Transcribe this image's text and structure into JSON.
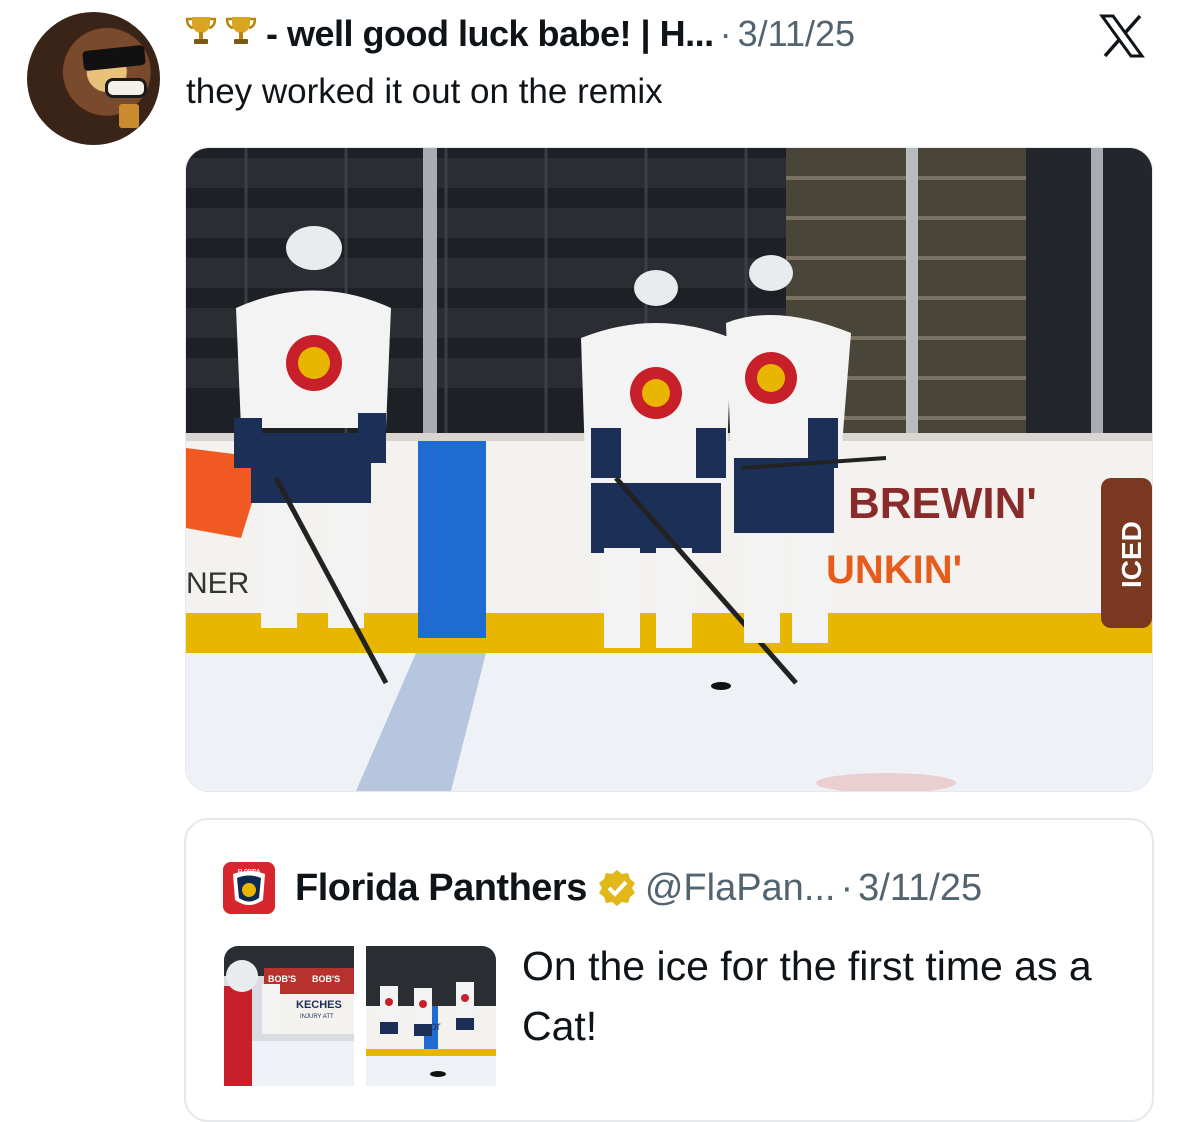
{
  "tweet": {
    "author_display": "- well good luck babe! | H...",
    "trophy_icons": [
      "trophy-icon",
      "trophy-icon"
    ],
    "separator": "·",
    "date": "3/11/25",
    "text": "they worked it out on the remix",
    "platform_icon": "x-logo-icon"
  },
  "photo": {
    "board_text_left": "NER",
    "board_text_brewin": "BREWIN'",
    "board_text_unkin": "UNKIN'",
    "board_text_iced": "ICED"
  },
  "quoted_tweet": {
    "team_logo_text": "FLORIDA",
    "name": "Florida Panthers",
    "verified_icon": "verified-badge-icon",
    "handle": "@FlaPan...",
    "separator": "·",
    "date": "3/11/25",
    "text": "On the ice for the first time as a Cat!",
    "thumb1_texts": [
      "BOB'S",
      "BOB'S",
      "KECHES",
      "INJURY ATT"
    ],
    "thumb2_texts": [
      "rpr"
    ]
  },
  "colors": {
    "text_primary": "#0f1419",
    "text_secondary": "#536471",
    "border": "#e6e9ec",
    "panthers_red": "#d8262f",
    "verified_gold": "#e2b719"
  }
}
